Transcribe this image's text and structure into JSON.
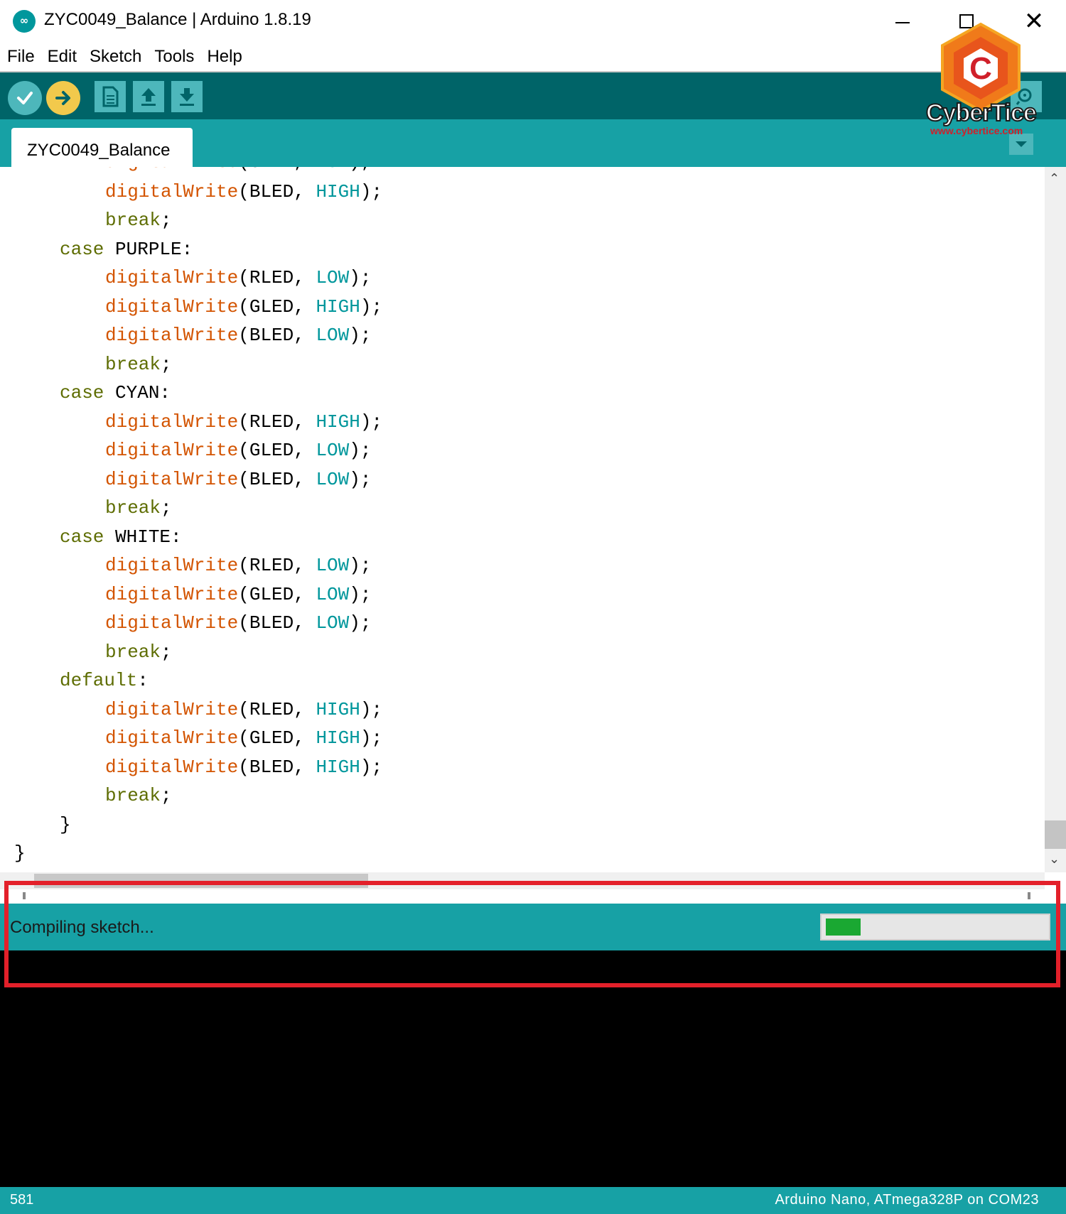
{
  "window": {
    "title": "ZYC0049_Balance | Arduino 1.8.19",
    "icon": "arduino-logo-icon"
  },
  "menu": [
    "File",
    "Edit",
    "Sketch",
    "Tools",
    "Help"
  ],
  "toolbar": {
    "buttons": [
      "verify",
      "upload",
      "new",
      "open",
      "save",
      "serial-monitor"
    ]
  },
  "tab": {
    "name": "ZYC0049_Balance"
  },
  "code": {
    "lines": [
      "digitalWrite(GLED, LOW);",
      "digitalWrite(BLED, HIGH);",
      "break;",
      "case PURPLE:",
      "digitalWrite(RLED, LOW);",
      "digitalWrite(GLED, HIGH);",
      "digitalWrite(BLED, LOW);",
      "break;",
      "case CYAN:",
      "digitalWrite(RLED, HIGH);",
      "digitalWrite(GLED, LOW);",
      "digitalWrite(BLED, LOW);",
      "break;",
      "case WHITE:",
      "digitalWrite(RLED, LOW);",
      "digitalWrite(GLED, LOW);",
      "digitalWrite(BLED, LOW);",
      "break;",
      "default:",
      "digitalWrite(RLED, HIGH);",
      "digitalWrite(GLED, HIGH);",
      "digitalWrite(BLED, HIGH);",
      "break;",
      "}",
      "}"
    ]
  },
  "status": {
    "message": "Compiling sketch...",
    "progress": 0.16
  },
  "footer": {
    "line_number": "581",
    "board": "Arduino Nano, ATmega328P on COM23"
  },
  "watermark": {
    "brand": "CyberTice",
    "url": "www.cybertice.com"
  },
  "colors": {
    "toolbar": "#006468",
    "tabbar": "#17a1a5",
    "highlight": "#e3202a",
    "progress": "#1aa832"
  }
}
